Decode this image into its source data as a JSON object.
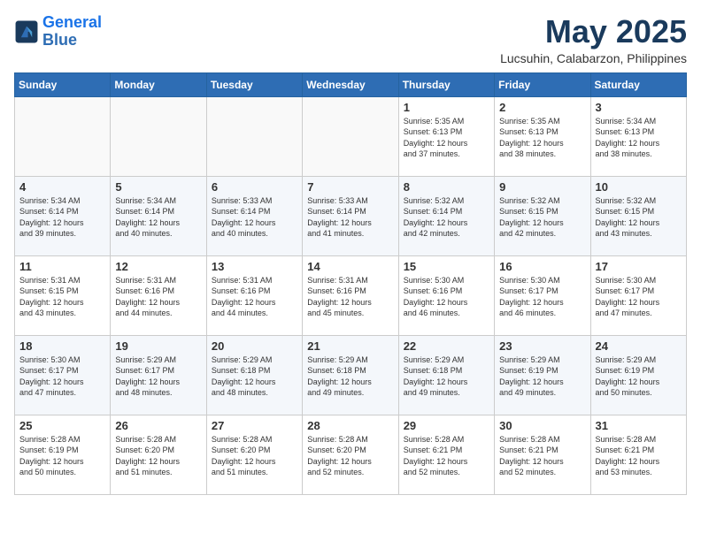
{
  "logo": {
    "line1": "General",
    "line2": "Blue"
  },
  "title": "May 2025",
  "subtitle": "Lucsuhin, Calabarzon, Philippines",
  "weekdays": [
    "Sunday",
    "Monday",
    "Tuesday",
    "Wednesday",
    "Thursday",
    "Friday",
    "Saturday"
  ],
  "weeks": [
    [
      {
        "day": "",
        "info": ""
      },
      {
        "day": "",
        "info": ""
      },
      {
        "day": "",
        "info": ""
      },
      {
        "day": "",
        "info": ""
      },
      {
        "day": "1",
        "info": "Sunrise: 5:35 AM\nSunset: 6:13 PM\nDaylight: 12 hours\nand 37 minutes."
      },
      {
        "day": "2",
        "info": "Sunrise: 5:35 AM\nSunset: 6:13 PM\nDaylight: 12 hours\nand 38 minutes."
      },
      {
        "day": "3",
        "info": "Sunrise: 5:34 AM\nSunset: 6:13 PM\nDaylight: 12 hours\nand 38 minutes."
      }
    ],
    [
      {
        "day": "4",
        "info": "Sunrise: 5:34 AM\nSunset: 6:14 PM\nDaylight: 12 hours\nand 39 minutes."
      },
      {
        "day": "5",
        "info": "Sunrise: 5:34 AM\nSunset: 6:14 PM\nDaylight: 12 hours\nand 40 minutes."
      },
      {
        "day": "6",
        "info": "Sunrise: 5:33 AM\nSunset: 6:14 PM\nDaylight: 12 hours\nand 40 minutes."
      },
      {
        "day": "7",
        "info": "Sunrise: 5:33 AM\nSunset: 6:14 PM\nDaylight: 12 hours\nand 41 minutes."
      },
      {
        "day": "8",
        "info": "Sunrise: 5:32 AM\nSunset: 6:14 PM\nDaylight: 12 hours\nand 42 minutes."
      },
      {
        "day": "9",
        "info": "Sunrise: 5:32 AM\nSunset: 6:15 PM\nDaylight: 12 hours\nand 42 minutes."
      },
      {
        "day": "10",
        "info": "Sunrise: 5:32 AM\nSunset: 6:15 PM\nDaylight: 12 hours\nand 43 minutes."
      }
    ],
    [
      {
        "day": "11",
        "info": "Sunrise: 5:31 AM\nSunset: 6:15 PM\nDaylight: 12 hours\nand 43 minutes."
      },
      {
        "day": "12",
        "info": "Sunrise: 5:31 AM\nSunset: 6:16 PM\nDaylight: 12 hours\nand 44 minutes."
      },
      {
        "day": "13",
        "info": "Sunrise: 5:31 AM\nSunset: 6:16 PM\nDaylight: 12 hours\nand 44 minutes."
      },
      {
        "day": "14",
        "info": "Sunrise: 5:31 AM\nSunset: 6:16 PM\nDaylight: 12 hours\nand 45 minutes."
      },
      {
        "day": "15",
        "info": "Sunrise: 5:30 AM\nSunset: 6:16 PM\nDaylight: 12 hours\nand 46 minutes."
      },
      {
        "day": "16",
        "info": "Sunrise: 5:30 AM\nSunset: 6:17 PM\nDaylight: 12 hours\nand 46 minutes."
      },
      {
        "day": "17",
        "info": "Sunrise: 5:30 AM\nSunset: 6:17 PM\nDaylight: 12 hours\nand 47 minutes."
      }
    ],
    [
      {
        "day": "18",
        "info": "Sunrise: 5:30 AM\nSunset: 6:17 PM\nDaylight: 12 hours\nand 47 minutes."
      },
      {
        "day": "19",
        "info": "Sunrise: 5:29 AM\nSunset: 6:17 PM\nDaylight: 12 hours\nand 48 minutes."
      },
      {
        "day": "20",
        "info": "Sunrise: 5:29 AM\nSunset: 6:18 PM\nDaylight: 12 hours\nand 48 minutes."
      },
      {
        "day": "21",
        "info": "Sunrise: 5:29 AM\nSunset: 6:18 PM\nDaylight: 12 hours\nand 49 minutes."
      },
      {
        "day": "22",
        "info": "Sunrise: 5:29 AM\nSunset: 6:18 PM\nDaylight: 12 hours\nand 49 minutes."
      },
      {
        "day": "23",
        "info": "Sunrise: 5:29 AM\nSunset: 6:19 PM\nDaylight: 12 hours\nand 49 minutes."
      },
      {
        "day": "24",
        "info": "Sunrise: 5:29 AM\nSunset: 6:19 PM\nDaylight: 12 hours\nand 50 minutes."
      }
    ],
    [
      {
        "day": "25",
        "info": "Sunrise: 5:28 AM\nSunset: 6:19 PM\nDaylight: 12 hours\nand 50 minutes."
      },
      {
        "day": "26",
        "info": "Sunrise: 5:28 AM\nSunset: 6:20 PM\nDaylight: 12 hours\nand 51 minutes."
      },
      {
        "day": "27",
        "info": "Sunrise: 5:28 AM\nSunset: 6:20 PM\nDaylight: 12 hours\nand 51 minutes."
      },
      {
        "day": "28",
        "info": "Sunrise: 5:28 AM\nSunset: 6:20 PM\nDaylight: 12 hours\nand 52 minutes."
      },
      {
        "day": "29",
        "info": "Sunrise: 5:28 AM\nSunset: 6:21 PM\nDaylight: 12 hours\nand 52 minutes."
      },
      {
        "day": "30",
        "info": "Sunrise: 5:28 AM\nSunset: 6:21 PM\nDaylight: 12 hours\nand 52 minutes."
      },
      {
        "day": "31",
        "info": "Sunrise: 5:28 AM\nSunset: 6:21 PM\nDaylight: 12 hours\nand 53 minutes."
      }
    ]
  ]
}
